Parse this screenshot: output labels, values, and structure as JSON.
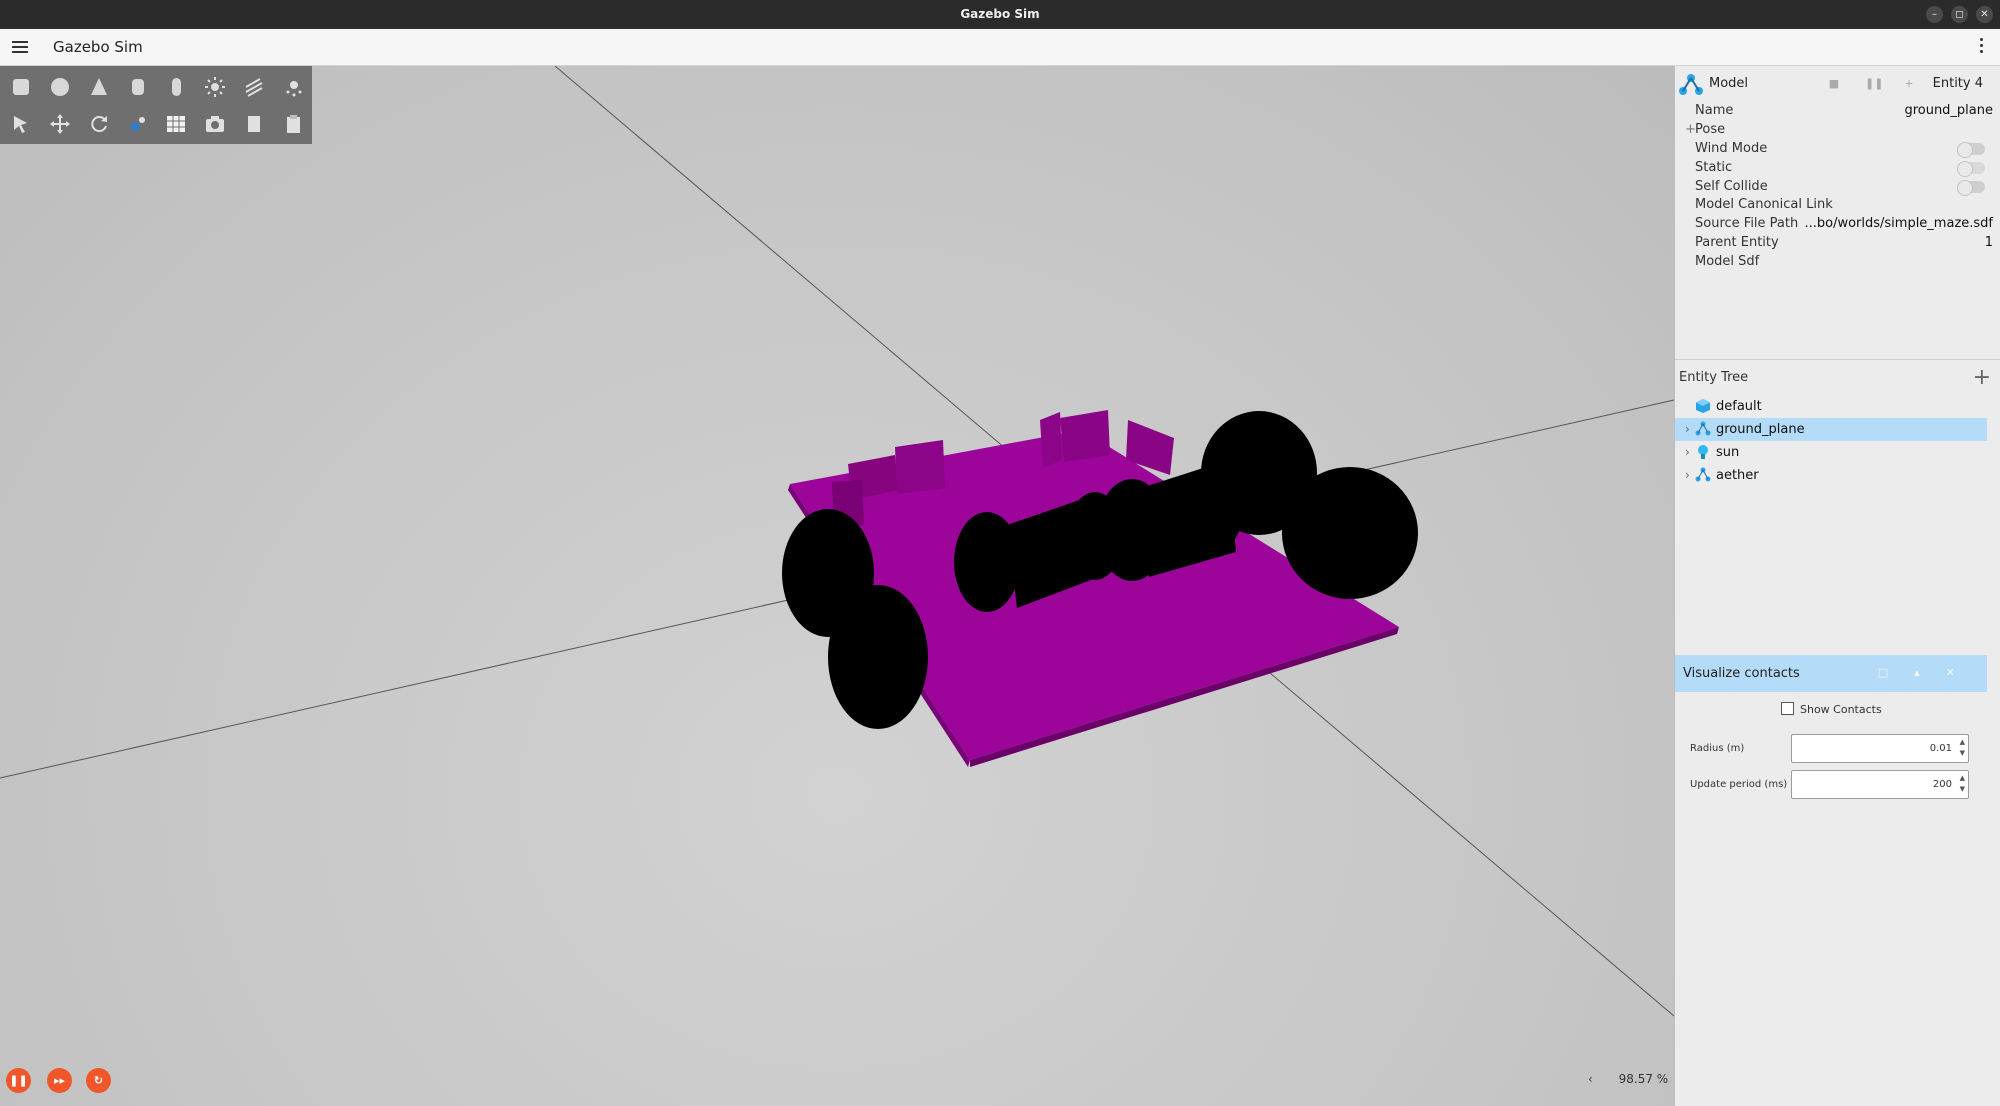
{
  "window": {
    "title": "Gazebo Sim"
  },
  "app": {
    "title": "Gazebo Sim"
  },
  "toolbar": {
    "row1": [
      "box-icon",
      "sphere-icon",
      "cone-icon",
      "cylinder-icon",
      "capsule-icon",
      "sun-icon",
      "directional-light-icon",
      "point-light-icon"
    ],
    "row2": [
      "select-icon",
      "translate-icon",
      "rotate-icon",
      "snap-icon",
      "grid-icon",
      "screenshot-icon",
      "copy-icon",
      "paste-icon"
    ]
  },
  "status": {
    "rtf": "98.57 %",
    "collapse": "‹"
  },
  "component_inspector": {
    "type_label": "Model",
    "entity_label": "Entity 4",
    "properties": [
      {
        "key": "Name",
        "value": "ground_plane"
      },
      {
        "key": "Pose",
        "value": ""
      },
      {
        "key": "Wind Mode",
        "value": ""
      },
      {
        "key": "Static",
        "value": ""
      },
      {
        "key": "Self Collide",
        "value": ""
      },
      {
        "key": "Model Canonical Link",
        "value": ""
      },
      {
        "key": "Source File Path",
        "value": "...bo/worlds/simple_maze.sdf"
      },
      {
        "key": "Parent Entity",
        "value": "1"
      },
      {
        "key": "Model Sdf",
        "value": ""
      }
    ],
    "pose_prefix": "+"
  },
  "entity_tree": {
    "title": "Entity Tree",
    "add": "+",
    "items": [
      {
        "label": "default",
        "icon": "world-cube-icon",
        "arrow": ""
      },
      {
        "label": "ground_plane",
        "icon": "model-icon",
        "arrow": "›"
      },
      {
        "label": "sun",
        "icon": "light-bulb-icon",
        "arrow": "›"
      },
      {
        "label": "aether",
        "icon": "model-icon",
        "arrow": "›"
      }
    ]
  },
  "visualize_contacts": {
    "title": "Visualize contacts",
    "show_contacts": "Show Contacts",
    "radius_label": "Radius (m)",
    "radius_value": "0.01",
    "period_label": "Update period (ms)",
    "period_value": "200"
  },
  "colors": {
    "robot": "#9a0399",
    "wheels": "#000000",
    "selection": "#b4dcf8",
    "play": "#f0562a"
  }
}
